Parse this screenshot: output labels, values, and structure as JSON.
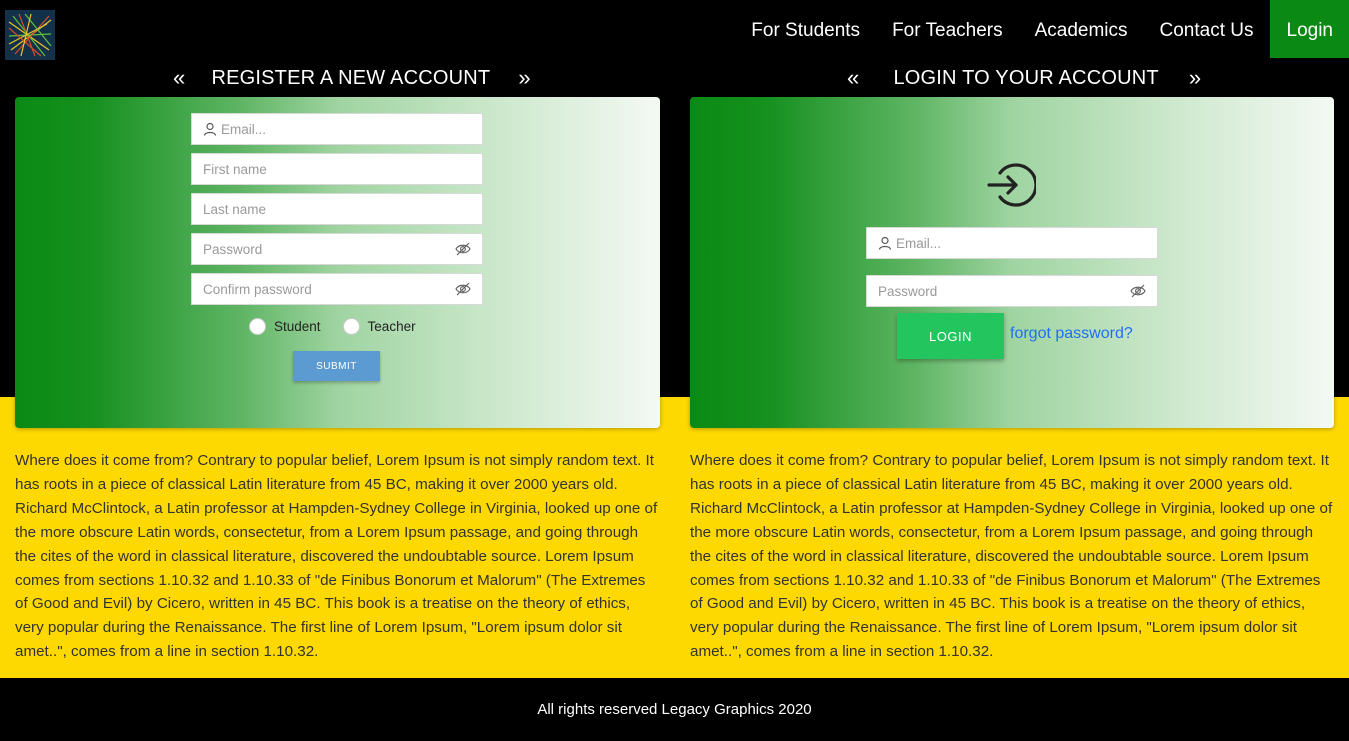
{
  "nav": {
    "items": [
      {
        "label": "For Students"
      },
      {
        "label": "For Teachers"
      },
      {
        "label": "Academics"
      },
      {
        "label": "Contact Us"
      },
      {
        "label": "Login"
      }
    ]
  },
  "register": {
    "title": "REGISTER A NEW ACCOUNT",
    "prev_arrow": "«",
    "next_arrow": "»",
    "email_placeholder": "Email...",
    "first_name_placeholder": "First name",
    "last_name_placeholder": "Last name",
    "password_placeholder": "Password",
    "confirm_password_placeholder": "Confirm password",
    "role_student": "Student",
    "role_teacher": "Teacher",
    "submit_label": "SUBMIT"
  },
  "login": {
    "title": "LOGIN TO YOUR ACCOUNT",
    "prev_arrow": "«",
    "next_arrow": "»",
    "email_placeholder": "Email...",
    "password_placeholder": "Password",
    "login_label": "LOGIN",
    "forgot_label": "forgot password?"
  },
  "content": {
    "left_text": "Where does it come from? Contrary to popular belief, Lorem Ipsum is not simply random text. It has roots in a piece of classical Latin literature from 45 BC, making it over 2000 years old. Richard McClintock, a Latin professor at Hampden-Sydney College in Virginia, looked up one of the more obscure Latin words, consectetur, from a Lorem Ipsum passage, and going through the cites of the word in classical literature, discovered the undoubtable source. Lorem Ipsum comes from sections 1.10.32 and 1.10.33 of \"de Finibus Bonorum et Malorum\" (The Extremes of Good and Evil) by Cicero, written in 45 BC. This book is a treatise on the theory of ethics, very popular during the Renaissance. The first line of Lorem Ipsum, \"Lorem ipsum dolor sit amet..\", comes from a line in section 1.10.32.",
    "right_text": "Where does it come from? Contrary to popular belief, Lorem Ipsum is not simply random text. It has roots in a piece of classical Latin literature from 45 BC, making it over 2000 years old. Richard McClintock, a Latin professor at Hampden-Sydney College in Virginia, looked up one of the more obscure Latin words, consectetur, from a Lorem Ipsum passage, and going through the cites of the word in classical literature, discovered the undoubtable source. Lorem Ipsum comes from sections 1.10.32 and 1.10.33 of \"de Finibus Bonorum et Malorum\" (The Extremes of Good and Evil) by Cicero, written in 45 BC. This book is a treatise on the theory of ethics, very popular during the Renaissance. The first line of Lorem Ipsum, \"Lorem ipsum dolor sit amet..\", comes from a line in section 1.10.32."
  },
  "footer": {
    "text": "All rights reserved Legacy Graphics 2020"
  },
  "icons": {
    "logo": "logo-icon",
    "user": "user-icon",
    "eye": "eye-off-icon",
    "login": "login-arrow-icon"
  },
  "colors": {
    "nav_active": "#0a8a14",
    "band": "#fed801",
    "submit": "#5c9bd1",
    "login": "#22c55e",
    "link": "#1f6ff5"
  }
}
